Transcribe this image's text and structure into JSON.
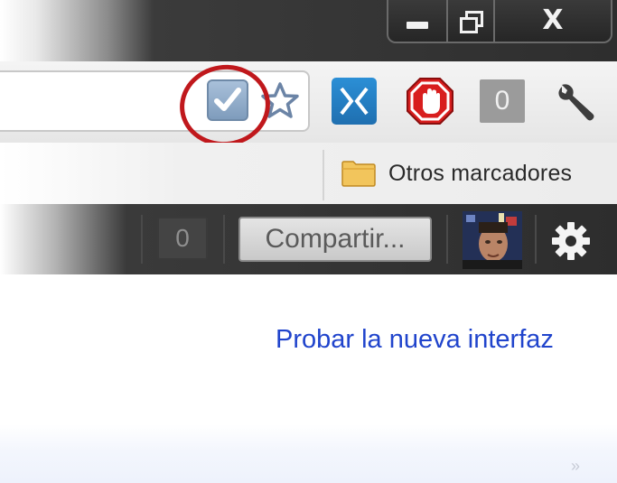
{
  "window_controls": {
    "minimize_icon": "minimize-icon",
    "maximize_icon": "restore-icon",
    "close_label": "X"
  },
  "toolbar": {
    "extension_badge_count": "0",
    "icons": [
      "checkmark-extension-icon",
      "bookmark-star-icon",
      "x-extension-icon",
      "adblock-hand-icon",
      "wrench-icon"
    ],
    "highlight_color": "#c0181c"
  },
  "bookmarks_bar": {
    "other_bookmarks_label": "Otros marcadores"
  },
  "google_bar": {
    "notification_count": "0",
    "share_button_label": "Compartir...",
    "avatar": "profile-photo",
    "settings_icon": "gear-icon"
  },
  "page": {
    "try_new_interface_link": "Probar la nueva interfaz"
  },
  "colors": {
    "link": "#2044cc",
    "dark_bar": "#2d2d2d",
    "accent_blue": "#2b8fd6"
  }
}
